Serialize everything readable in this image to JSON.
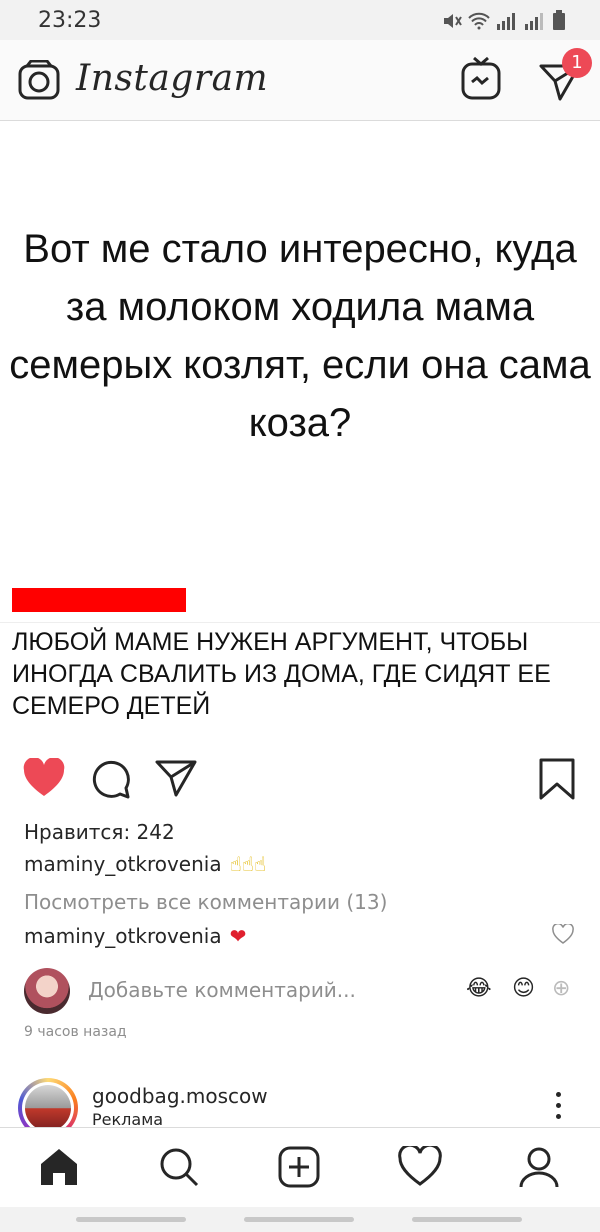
{
  "status": {
    "time": "23:23"
  },
  "appbar": {
    "logo": "Instagram",
    "notifications": "1"
  },
  "post": {
    "image_text": "Вот ме стало интересно, куда за молоком ходила мама семерых козлят, если она сама коза?",
    "image_caption": "ЛЮБОЙ МАМЕ НУЖЕН АРГУМЕНТ, ЧТОБЫ ИНОГДА СВАЛИТЬ ИЗ ДОМА, ГДЕ СИДЯТ ЕЕ СЕМЕРО ДЕТЕЙ",
    "likes": "Нравится: 242",
    "author": "maminy_otkrovenia",
    "author_emoji": "☝☝☝",
    "view_all": "Посмотреть все комментарии (13)",
    "comment_author": "maminy_otkrovenia",
    "comment_emoji": "❤",
    "add_comment_placeholder": "Добавьте комментарий...",
    "emoji1": "😂",
    "emoji2": "😊",
    "emoji_plus": "⊕",
    "time_ago": "9 часов назад"
  },
  "next_post": {
    "username": "goodbag.moscow",
    "sponsored": "Реклама"
  },
  "colors": {
    "like_red": "#ed4956",
    "accent_red": "#ff0000"
  }
}
